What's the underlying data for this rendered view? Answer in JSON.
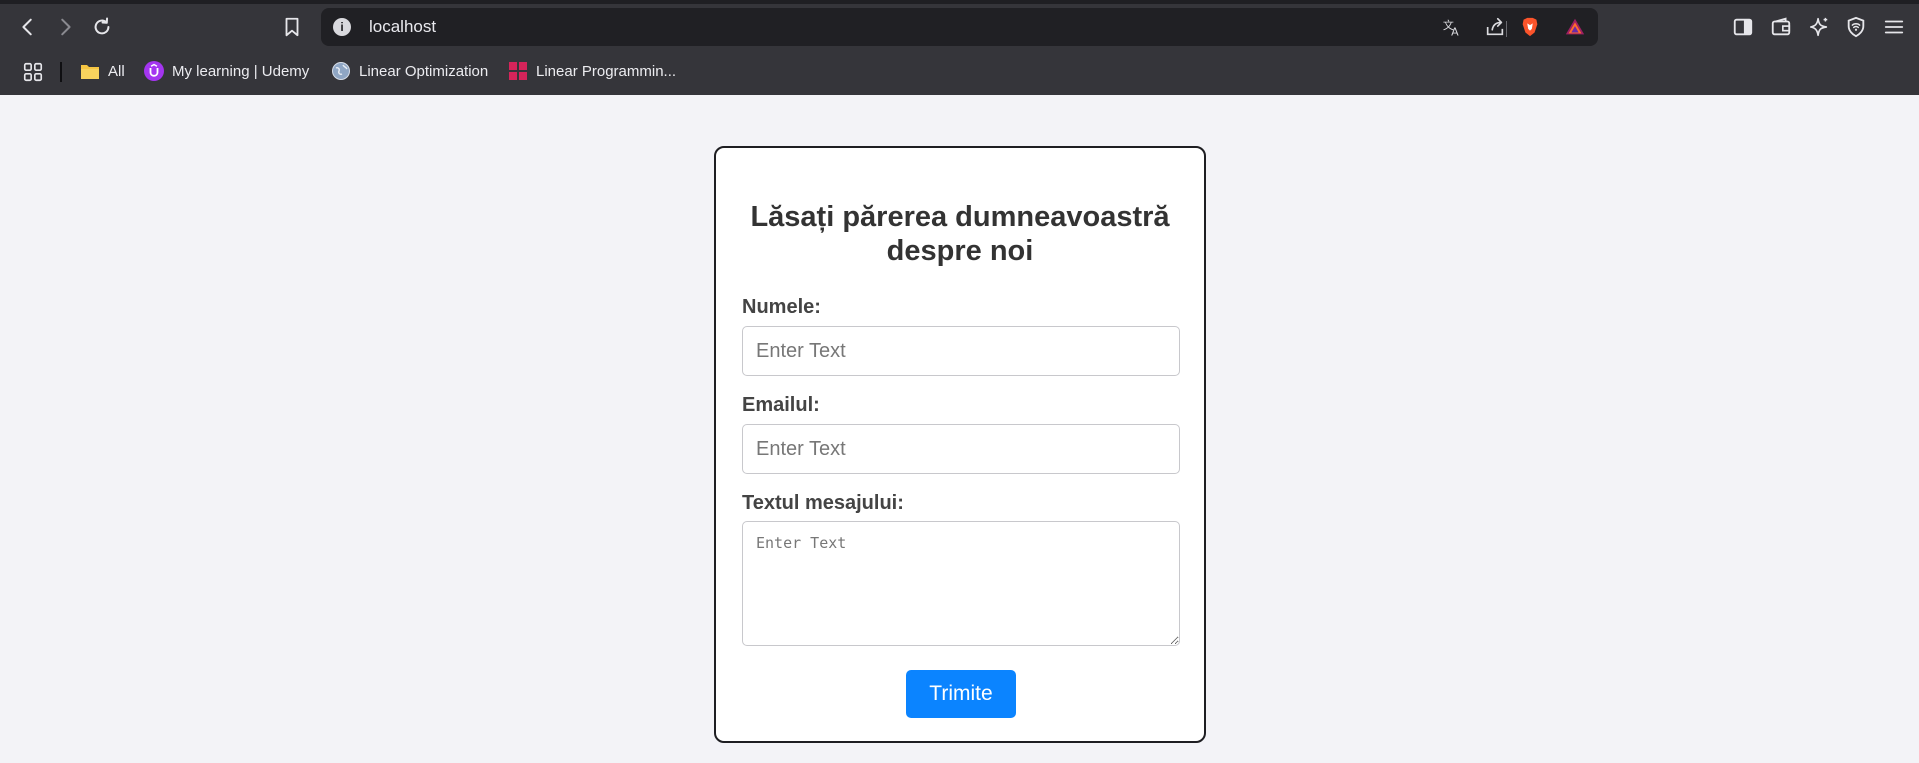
{
  "browser": {
    "url": "localhost",
    "bookmarks": [
      {
        "label": "All",
        "icon": "folder-icon"
      },
      {
        "label": "My learning | Udemy",
        "icon": "udemy-icon"
      },
      {
        "label": "Linear Optimization",
        "icon": "globe-icon"
      },
      {
        "label": "Linear Programmin...",
        "icon": "grid-logo-icon"
      }
    ],
    "colors": {
      "chrome": "#35353a",
      "urlbar": "#202024",
      "brave": "#fb542b"
    }
  },
  "form": {
    "title": "Lăsați părerea dumneavoastră despre noi",
    "name_label": "Numele:",
    "name_placeholder": "Enter Text",
    "email_label": "Emailul:",
    "email_placeholder": "Enter Text",
    "message_label": "Textul mesajului:",
    "message_placeholder": "Enter Text",
    "submit_label": "Trimite",
    "colors": {
      "accent": "#0b84ff",
      "text": "#333333",
      "background": "#f3f3f7"
    }
  }
}
